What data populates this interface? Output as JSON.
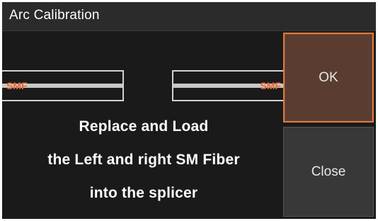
{
  "dialog": {
    "title": "Arc Calibration"
  },
  "fibers": {
    "left_label": "SMF",
    "right_label": "SMF"
  },
  "message": {
    "line1": "Replace and Load",
    "line2": "the Left and right SM Fiber",
    "line3": "into the splicer"
  },
  "buttons": {
    "ok_label": "OK",
    "close_label": "Close"
  },
  "colors": {
    "background": "#1a1a1a",
    "ok_button": "#5a3d30",
    "ok_border": "#e27a3c",
    "close_button": "#383838",
    "fiber_label": "#e8642e"
  }
}
